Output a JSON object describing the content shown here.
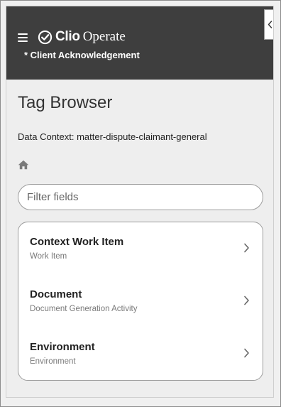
{
  "header": {
    "brand_name": "Clio",
    "brand_product": "Operate",
    "matter_name": "* Client Acknowledgement",
    "icons": [
      "menu-icon",
      "clio-logo-icon",
      "collapse-left-icon"
    ],
    "background_color": "#3e3e3e"
  },
  "page": {
    "title": "Tag Browser",
    "data_context_label": "Data Context: matter-dispute-claimant-general"
  },
  "breadcrumb": {
    "icon": "home-icon"
  },
  "filter": {
    "placeholder": "Filter fields",
    "value": ""
  },
  "items": [
    {
      "title": "Context Work Item",
      "subtitle": "Work Item",
      "icon": "chevron-right-icon"
    },
    {
      "title": "Document",
      "subtitle": "Document Generation Activity",
      "icon": "chevron-right-icon"
    },
    {
      "title": "Environment",
      "subtitle": "Environment",
      "icon": "chevron-right-icon"
    }
  ]
}
